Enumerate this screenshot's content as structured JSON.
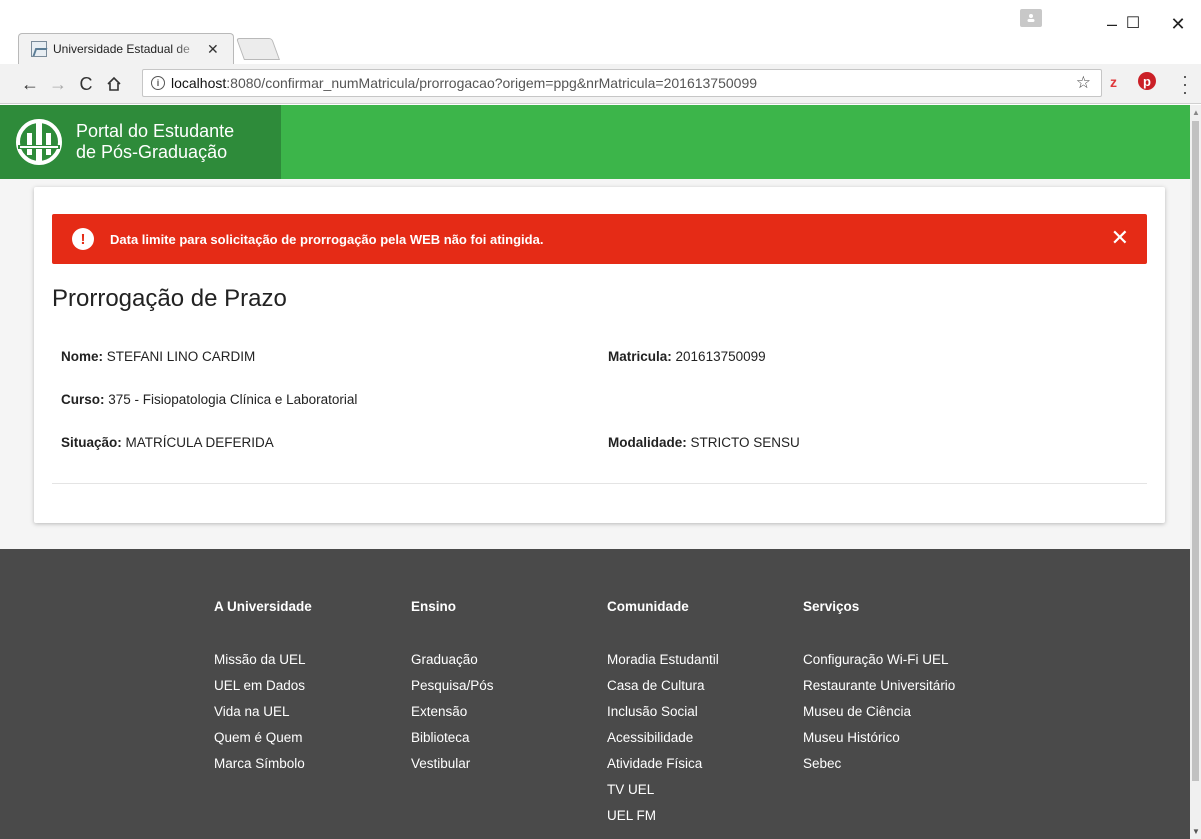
{
  "browser": {
    "tab_title": "Universidade Estadual de",
    "tab_close": "✕",
    "window_controls": {
      "minimize": "–",
      "maximize": "☐",
      "close": "✕"
    },
    "url_host": "localhost",
    "url_rest": ":8080/confirmar_numMatricula/prorrogacao?origem=ppg&nrMatricula=201613750099"
  },
  "header": {
    "brand_line1": "Portal do Estudante",
    "brand_line2": "de Pós-Graduação"
  },
  "alert": {
    "message": "Data limite para solicitação de prorrogação pela WEB não foi atingida.",
    "close": "✕"
  },
  "page": {
    "title": "Prorrogação de Prazo",
    "fields": {
      "nome_label": "Nome:",
      "nome_value": "STEFANI LINO CARDIM",
      "matricula_label": "Matricula:",
      "matricula_value": "201613750099",
      "curso_label": "Curso:",
      "curso_value": "375 - Fisiopatologia Clínica e Laboratorial",
      "situacao_label": "Situação:",
      "situacao_value": "MATRÍCULA DEFERIDA",
      "modalidade_label": "Modalidade:",
      "modalidade_value": "STRICTO SENSU"
    }
  },
  "footer": {
    "columns": [
      {
        "heading": "A Universidade",
        "links": [
          "Missão da UEL",
          "UEL em Dados",
          "Vida na UEL",
          "Quem é Quem",
          "Marca Símbolo"
        ]
      },
      {
        "heading": "Ensino",
        "links": [
          "Graduação",
          "Pesquisa/Pós",
          "Extensão",
          "Biblioteca",
          "Vestibular"
        ]
      },
      {
        "heading": "Comunidade",
        "links": [
          "Moradia Estudantil",
          "Casa de Cultura",
          "Inclusão Social",
          "Acessibilidade",
          "Atividade Física",
          "TV UEL",
          "UEL FM"
        ]
      },
      {
        "heading": "Serviços",
        "links": [
          "Configuração Wi-Fi UEL",
          "Restaurante Universitário",
          "Museu de Ciência",
          "Museu Histórico",
          "Sebec"
        ]
      }
    ]
  },
  "colors": {
    "header_green": "#3cb54a",
    "brand_green": "#2e8b3a",
    "alert_red": "#e52b16",
    "footer_gray": "#4a4a4a"
  }
}
